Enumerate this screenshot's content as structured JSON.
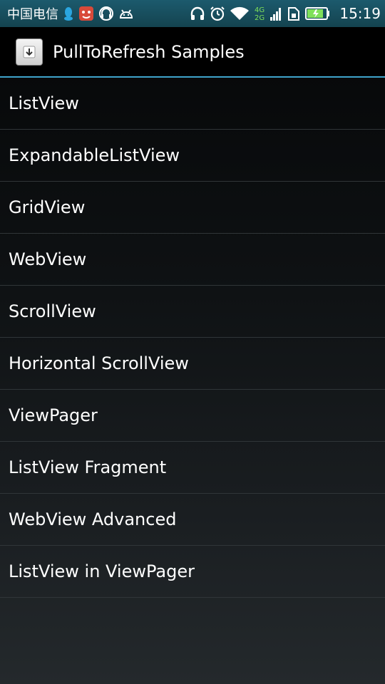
{
  "status_bar": {
    "carrier": "中国电信",
    "time": "15:19",
    "network_top": "4G",
    "network_bottom": "2G",
    "left_icons": [
      "qq-icon",
      "notification-app-icon",
      "headset-app-icon",
      "android-icon"
    ],
    "right_icons": [
      "headphones-icon",
      "alarm-icon",
      "wifi-icon",
      "cellular-signal-icon",
      "sim-icon",
      "battery-charging-icon"
    ],
    "colors": {
      "background": "#17505f",
      "battery": "#7fe05a"
    }
  },
  "action_bar": {
    "title": "PullToRefresh Samples",
    "icon": "download-app-icon",
    "divider_color": "#3ea2c9"
  },
  "samples": [
    {
      "label": "ListView"
    },
    {
      "label": "ExpandableListView"
    },
    {
      "label": "GridView"
    },
    {
      "label": "WebView"
    },
    {
      "label": "ScrollView"
    },
    {
      "label": "Horizontal ScrollView"
    },
    {
      "label": "ViewPager"
    },
    {
      "label": "ListView Fragment"
    },
    {
      "label": "WebView Advanced"
    },
    {
      "label": "ListView in ViewPager"
    }
  ]
}
